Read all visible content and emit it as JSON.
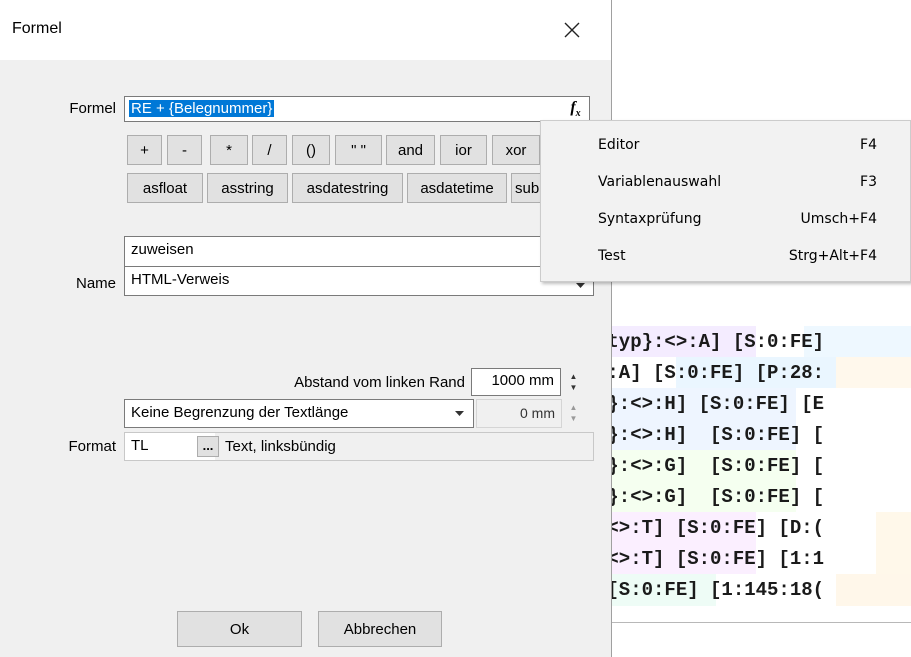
{
  "dialog": {
    "title": "Formel",
    "close_label": "✕"
  },
  "formel": {
    "label": "Formel",
    "value": "RE + {Belegnummer}",
    "fx_label": "fx"
  },
  "operators": {
    "row1": [
      "+",
      "-",
      "*",
      "/",
      "()",
      "\" \"",
      "and",
      "ior",
      "xor"
    ],
    "row2": [
      "asfloat",
      "asstring",
      "asdatestring",
      "asdatetime",
      "sub"
    ]
  },
  "name": {
    "label": "Name",
    "assign_value": "zuweisen",
    "value": "HTML-Verweis"
  },
  "position": {
    "label": "Abstand vom linken Rand",
    "value": "1000 mm"
  },
  "length": {
    "value": "Keine Begrenzung der Textlänge",
    "mm_value": "0 mm"
  },
  "format": {
    "label": "Format",
    "code": "TL",
    "ellipsis": "...",
    "description": "Text, linksbündig"
  },
  "buttons": {
    "ok": "Ok",
    "cancel": "Abbrechen"
  },
  "context_menu": {
    "items": [
      {
        "label": "Editor",
        "shortcut": "F4"
      },
      {
        "label": "Variablenauswahl",
        "shortcut": "F3"
      },
      {
        "label": "Syntaxprüfung",
        "shortcut": "Umsch+F4"
      },
      {
        "label": "Test",
        "shortcut": "Strg+Alt+F4"
      }
    ]
  },
  "code_lines": [
    "ntyp}:<>:A] [S:0:FE]",
    ">:A] [S:0:FE] [P:28:",
    "o}:<>:H] [S:0:FE] [E",
    "o}:<>:H]  [S:0:FE] [",
    "o}:<>:G]  [S:0:FE] [",
    "o}:<>:G]  [S:0:FE] [",
    ":<>:T] [S:0:FE] [D:(",
    ":<>:T] [S:0:FE] [1:1",
    " [S:0:FE] [1:145:18("
  ]
}
